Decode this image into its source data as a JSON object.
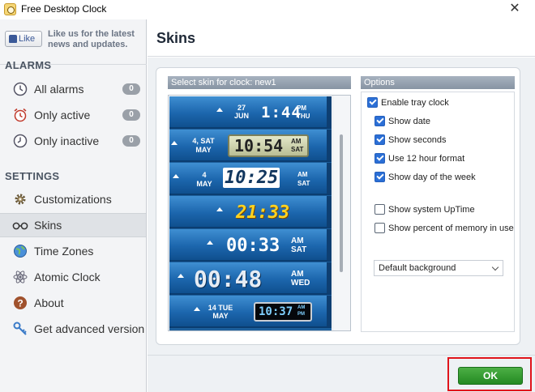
{
  "window": {
    "title": "Free Desktop Clock",
    "close_symbol": "✕"
  },
  "sidebar": {
    "like_label": "Like",
    "like_text": "Like us for the latest news and updates.",
    "alarms_heading": "ALARMS",
    "alarms": [
      {
        "label": "All alarms",
        "count": "0",
        "icon": "clock-icon"
      },
      {
        "label": "Only active",
        "count": "0",
        "icon": "alarm-clock-icon"
      },
      {
        "label": "Only inactive",
        "count": "0",
        "icon": "clock-icon"
      }
    ],
    "settings_heading": "SETTINGS",
    "settings": [
      {
        "label": "Customizations",
        "icon": "gear-icon",
        "active": false
      },
      {
        "label": "Skins",
        "icon": "glasses-icon",
        "active": true
      },
      {
        "label": "Time Zones",
        "icon": "globe-icon",
        "active": false
      },
      {
        "label": "Atomic Clock",
        "icon": "atom-icon",
        "active": false
      },
      {
        "label": "About",
        "icon": "question-icon",
        "active": false
      },
      {
        "label": "Get advanced version",
        "icon": "key-icon",
        "active": false
      }
    ]
  },
  "header": {
    "title": "Skins"
  },
  "skins": {
    "group_label": "Select skin for clock: new1",
    "items": [
      {
        "date_top": "27",
        "date_bottom": "JUN",
        "time": "1:44",
        "suffix_top": "PM",
        "suffix_bottom": "THU"
      },
      {
        "date_top": "4, SAT",
        "date_bottom": "MAY",
        "time": "10:54",
        "suffix_top": "AM",
        "suffix_bottom": "SAT"
      },
      {
        "date_top": "4",
        "date_bottom": "MAY",
        "time": "10:25",
        "suffix_top": "AM",
        "suffix_bottom": "SAT"
      },
      {
        "date_top": "",
        "date_bottom": "",
        "time": "21:33",
        "suffix_top": "",
        "suffix_bottom": ""
      },
      {
        "date_top": "",
        "date_bottom": "",
        "time": "00:33",
        "suffix_top": "AM",
        "suffix_bottom": "SAT"
      },
      {
        "date_top": "",
        "date_bottom": "",
        "time": "00:48",
        "suffix_top": "AM",
        "suffix_bottom": "WED"
      },
      {
        "date_top": "14 TUE",
        "date_bottom": "MAY",
        "time": "10:37",
        "suffix_top": "AM",
        "suffix_bottom": "PM"
      }
    ]
  },
  "options": {
    "group_label": "Options",
    "enable_tray_clock": {
      "label": "Enable tray clock",
      "checked": true
    },
    "show_date": {
      "label": "Show date",
      "checked": true
    },
    "show_seconds": {
      "label": "Show seconds",
      "checked": true
    },
    "use_12_hour": {
      "label": "Use 12 hour format",
      "checked": true
    },
    "show_day_of_week": {
      "label": "Show day of the week",
      "checked": true
    },
    "show_system_uptime": {
      "label": "Show system UpTime",
      "checked": false
    },
    "show_memory_percent": {
      "label": "Show percent of memory in use",
      "checked": false
    },
    "background_select": {
      "value": "Default background"
    }
  },
  "footer": {
    "ok_label": "OK"
  },
  "colors": {
    "ok_button": "#2f9a2c",
    "highlight_border": "#e0141b",
    "checkbox_checked": "#2b6fd6",
    "skin_blue": "#1c66ad"
  }
}
